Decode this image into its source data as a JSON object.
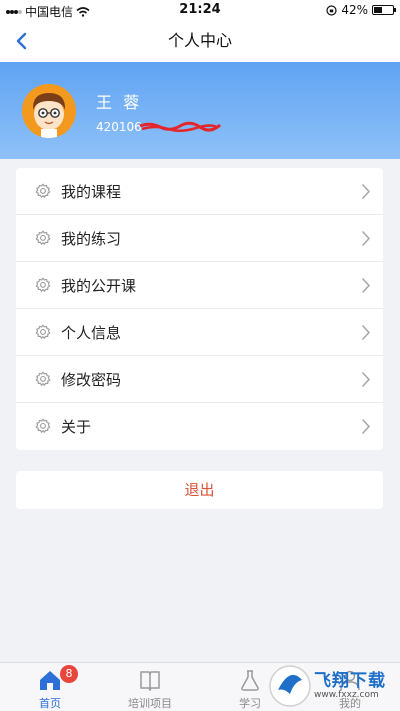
{
  "status_bar": {
    "carrier": "中国电信",
    "time": "21:24",
    "battery": "42%",
    "battery_level": 0.42
  },
  "header": {
    "title": "个人中心"
  },
  "profile": {
    "name": "王 蓉",
    "id_prefix": "420106"
  },
  "menu": {
    "items": [
      {
        "label": "我的课程"
      },
      {
        "label": "我的练习"
      },
      {
        "label": "我的公开课"
      },
      {
        "label": "个人信息"
      },
      {
        "label": "修改密码"
      },
      {
        "label": "关于"
      }
    ]
  },
  "logout": {
    "label": "退出"
  },
  "tabbar": {
    "tabs": [
      {
        "label": "首页",
        "icon": "home-icon",
        "badge": "8",
        "active": true
      },
      {
        "label": "培训项目",
        "icon": "book-icon"
      },
      {
        "label": "学习",
        "icon": "flask-icon"
      },
      {
        "label": "我的",
        "icon": "person-icon"
      }
    ]
  },
  "watermark": {
    "text": "飞翔下载",
    "url": "www.fxxz.com"
  },
  "colors": {
    "accent": "#2d6fd6",
    "header_gradient_top": "#5fa3f3",
    "logout": "#d9543a",
    "badge": "#e8453c"
  }
}
